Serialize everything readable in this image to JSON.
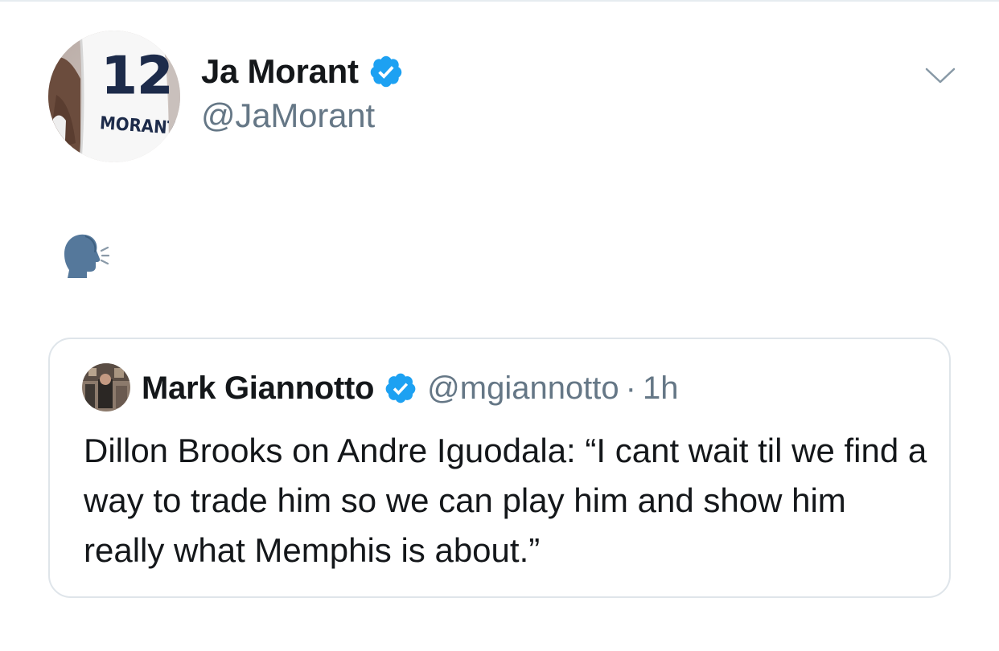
{
  "author": {
    "display_name": "Ja Morant",
    "handle": "@JaMorant",
    "verified": true,
    "avatar_jersey_number": "12",
    "avatar_jersey_name": "MORANT"
  },
  "tweet": {
    "emoji": "speaking-head-emoji"
  },
  "quoted_tweet": {
    "display_name": "Mark Giannotto",
    "handle": "@mgiannotto",
    "separator": "·",
    "time": "1h",
    "verified": true,
    "text": "Dillon Brooks on Andre Iguodala: “I cant wait til we find a way to trade him so we can play him and show him really what Memphis is about.”"
  },
  "icons": {
    "verified": "verified-badge-icon",
    "menu": "chevron-down-icon"
  },
  "colors": {
    "verified_blue": "#1da1f2",
    "secondary_text": "#657786",
    "primary_text": "#14171a",
    "border": "#dfe5ea"
  }
}
